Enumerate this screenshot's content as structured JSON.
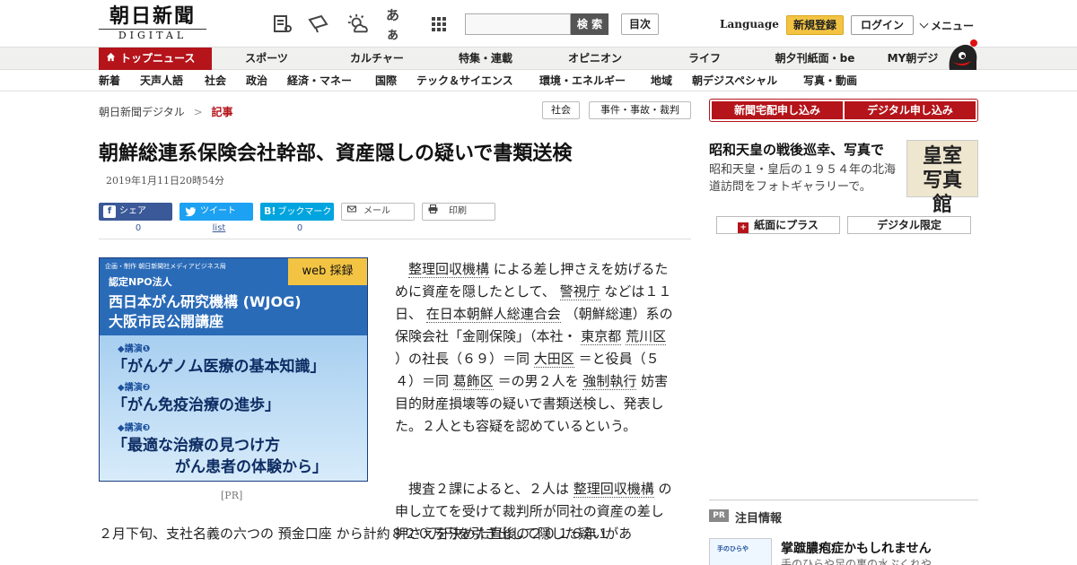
{
  "header": {
    "logo_jp": "朝日新聞",
    "logo_en": "DIGITAL",
    "icons": [
      "article-list-icon",
      "megaphone-icon",
      "weather-icon",
      "font-size-icon",
      "grid-icon"
    ],
    "font_size_label": "あぁ",
    "search_button": "検 索",
    "toc_button": "目次",
    "language": "Language",
    "register": "新規登録",
    "login": "ログイン",
    "menu": "メニュー"
  },
  "nav_main": {
    "top": "トップニュース",
    "items": [
      "スポーツ",
      "カルチャー",
      "特集・連載",
      "オピニオン",
      "ライフ",
      "朝夕刊紙面・be",
      "MY朝デジ"
    ]
  },
  "nav_sub": {
    "items": [
      "新着",
      "天声人語",
      "社会",
      "政治",
      "経済・マネー",
      "国際",
      "テック＆サイエンス",
      "環境・エネルギー",
      "地域",
      "朝デジスペシャル",
      "写真・動画"
    ]
  },
  "breadcrumb": {
    "home": "朝日新聞デジタル",
    "sep": ">",
    "current": "記事"
  },
  "tags": [
    "社会",
    "事件・事故・裁判"
  ],
  "article": {
    "title": "朝鮮総連系保険会社幹部、資産隠しの疑いで書類送検",
    "date": "2019年1月11日20時54分",
    "p1": [
      {
        "t": "　"
      },
      {
        "t": "整理回収機構",
        "link": true
      },
      {
        "t": " による差し押さえを妨げるために資産を隠したとして、 "
      },
      {
        "t": "警視庁",
        "link": true
      },
      {
        "t": " などは１１日、 "
      },
      {
        "t": "在日本朝鮮人総連合会",
        "link": true
      },
      {
        "t": " （朝鮮総連）系の保険会社「金剛保険」（本社・ "
      },
      {
        "t": "東京都",
        "link": true
      },
      {
        "t": " "
      },
      {
        "t": "荒川区",
        "link": true
      },
      {
        "t": " ）の社長（６９）＝同 "
      },
      {
        "t": "大田区",
        "link": true
      },
      {
        "t": " ＝と役員（５４）＝同 "
      },
      {
        "t": "葛飾区",
        "link": true
      },
      {
        "t": " ＝の男２人を "
      },
      {
        "t": "強制執行",
        "link": true
      },
      {
        "t": " 妨害目的財産損壊等の疑いで書類送検し、発表した。２人とも容疑を認めているという。"
      }
    ],
    "p2": [
      {
        "t": "　捜査２課によると、２人は "
      },
      {
        "t": "整理回収機構",
        "link": true
      },
      {
        "t": " の申し立てを受けて裁判所が同社の資産の差し押さえを決めた直後の２０１６年１"
      }
    ],
    "p3": [
      {
        "t": "２月下旬、支社名義の六つの "
      },
      {
        "t": "預金口座",
        "link": false
      },
      {
        "t": " から計約８２０万円を引き出して隠した疑いがあ"
      }
    ]
  },
  "share": {
    "facebook": "シェア",
    "twitter": "ツイート",
    "hatena": "ブックマーク",
    "hatena_icon": "B!",
    "mail": "メール",
    "print": "印刷",
    "facebook_count": "0",
    "twitter_count": "list",
    "hatena_count": "0"
  },
  "ad": {
    "producer": "企画・制作 朝日新聞社メディアビジネス局",
    "badge": "web 採録",
    "npo": "認定NPO法人",
    "org": "西日本がん研究機構 (WJOG)",
    "event": "大阪市民公開講座",
    "lectures": [
      {
        "label": "◆講演❶",
        "title": "「がんゲノム医療の基本知識」"
      },
      {
        "label": "◆講演❷",
        "title": "「がん免疫治療の進歩」"
      },
      {
        "label": "◆講演❸",
        "title": "「最適な治療の見つけ方",
        "title2": "がん患者の体験から」"
      }
    ],
    "pr": "[PR]"
  },
  "sidebar": {
    "subscribe_paper": "新聞宅配申し込み",
    "subscribe_digital": "デジタル申し込み",
    "feature_title": "昭和天皇の戦後巡幸、写真で",
    "feature_desc": "昭和天皇・皇后の１９５４年の北海道訪問をフォトギャラリーで。",
    "feature_img_text": "皇室写真館",
    "plus_paper": "紙面にプラス",
    "digital_only": "デジタル限定",
    "pr_badge": "PR",
    "attention": "注目情報",
    "promo_title": "掌蹠膿疱症かもしれません",
    "promo_sub": "手のひらや足の裏の水ぶくれや",
    "promo_img_text": "手のひらや"
  },
  "colors": {
    "brand_red": "#b4141a",
    "facebook": "#3b5998",
    "twitter": "#1da1f2",
    "hatena": "#00a4de",
    "register_yellow": "#f3c443"
  }
}
